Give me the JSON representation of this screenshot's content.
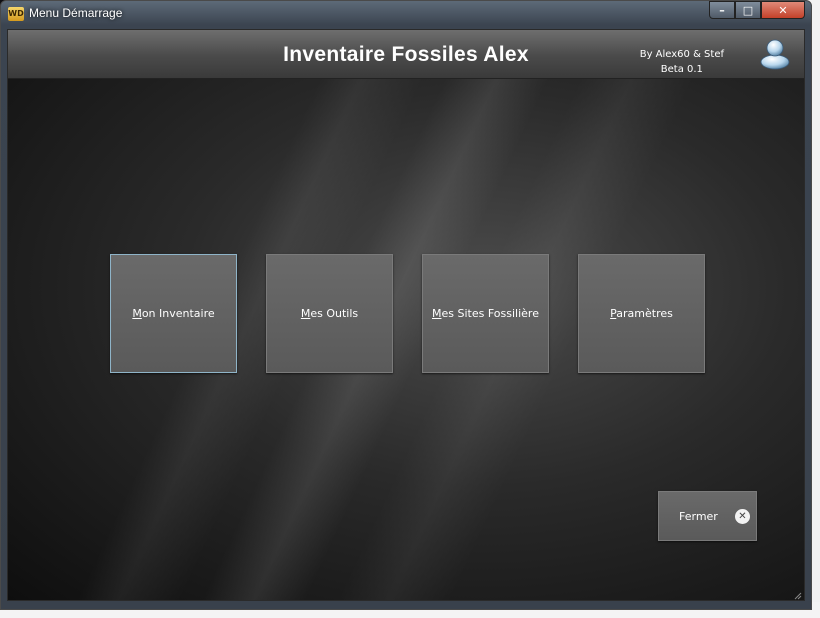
{
  "window": {
    "title": "Menu Démarrage",
    "icon": "windev-app-icon",
    "icon_text": "WD",
    "caption": {
      "minimize": "–",
      "maximize": "□",
      "close": "✕"
    }
  },
  "header": {
    "title": "Inventaire Fossiles Alex",
    "byline": "By Alex60 & Stef",
    "version": "Beta 0.1",
    "icon": "user-icon"
  },
  "tiles": [
    {
      "accel": "M",
      "rest": "on Inventaire",
      "focused": true
    },
    {
      "accel": "M",
      "rest": "es Outils",
      "focused": false
    },
    {
      "accel": "M",
      "rest": "es Sites Fossilière",
      "focused": false
    },
    {
      "accel": "P",
      "rest": "aramètres",
      "focused": false
    }
  ],
  "close_button": {
    "label": "Fermer",
    "icon": "close-circle-icon",
    "icon_glyph": "✕"
  },
  "colors": {
    "tile_bg": "#5f5f5f",
    "header_bg": "#4a4a4a",
    "focus_border": "#8fb4c8"
  }
}
